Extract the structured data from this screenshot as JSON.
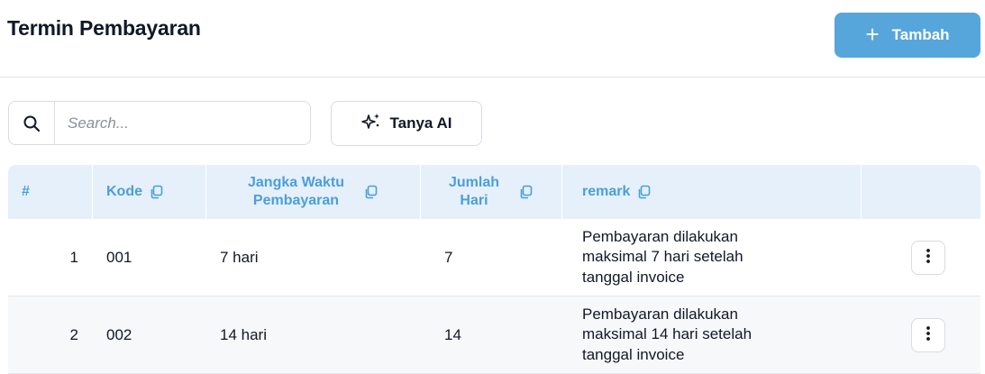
{
  "header": {
    "title": "Termin Pembayaran",
    "add_button_label": "Tambah"
  },
  "toolbar": {
    "search_placeholder": "Search...",
    "ai_button_label": "Tanya AI"
  },
  "table": {
    "columns": [
      {
        "label": "#"
      },
      {
        "label": "Kode"
      },
      {
        "label_line1": "Jangka Waktu",
        "label_line2": "Pembayaran"
      },
      {
        "label_line1": "Jumlah",
        "label_line2": "Hari"
      },
      {
        "label": "remark"
      }
    ],
    "rows": [
      {
        "index": "1",
        "kode": "001",
        "jangka_waktu": "7 hari",
        "jumlah_hari": "7",
        "remark": "Pembayaran dilakukan\nmaksimal 7 hari setelah\ntanggal invoice"
      },
      {
        "index": "2",
        "kode": "002",
        "jangka_waktu": "14 hari",
        "jumlah_hari": "14",
        "remark": "Pembayaran dilakukan\nmaksimal 14 hari setelah\ntanggal invoice"
      }
    ]
  },
  "colors": {
    "accent": "#56a6dc",
    "header_bg": "#e6f0fb",
    "header_text": "#4a9fd8"
  },
  "icons": [
    "plus-icon",
    "search-icon",
    "sparkle-icon",
    "copy-icon",
    "more-vertical-icon"
  ]
}
